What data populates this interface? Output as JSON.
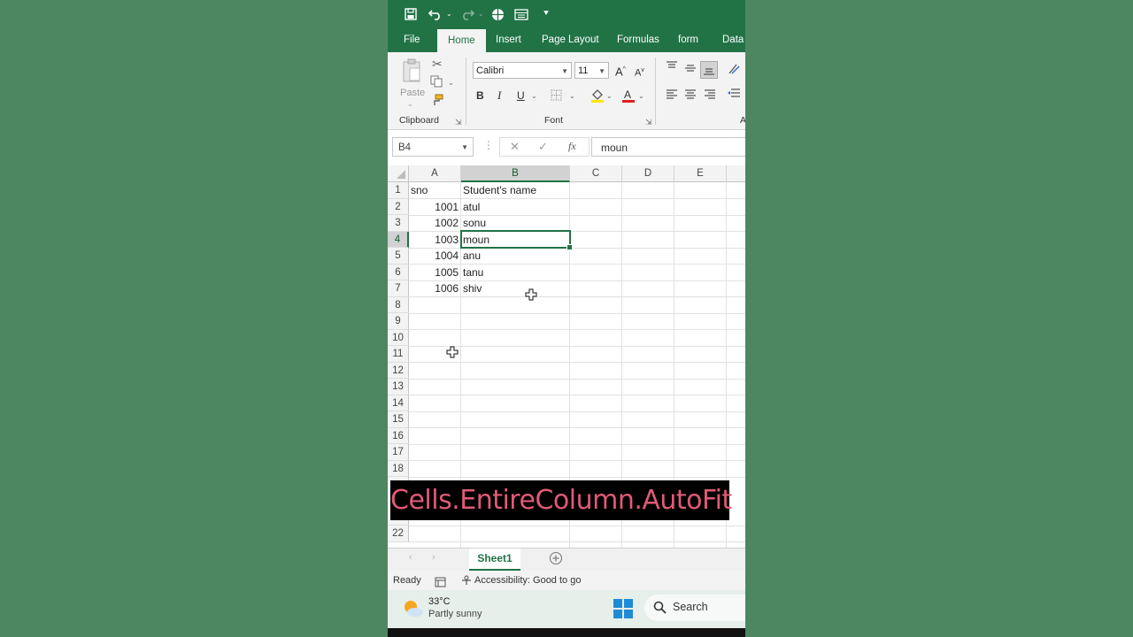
{
  "ribbon_tabs": [
    "File",
    "Home",
    "Insert",
    "Page Layout",
    "Formulas",
    "form",
    "Data"
  ],
  "ribbon": {
    "clipboard": {
      "paste_label": "Paste",
      "group_label": "Clipboard"
    },
    "font": {
      "font_name": "Calibri",
      "font_size": "11",
      "bold": "B",
      "italic": "I",
      "underline": "U",
      "group_label": "Font"
    },
    "alignment_group_label": "A"
  },
  "formula_bar": {
    "name_box": "B4",
    "fx_label": "fx",
    "value": "moun"
  },
  "columns": [
    "A",
    "B",
    "C",
    "D",
    "E"
  ],
  "rows": [
    "1",
    "2",
    "3",
    "4",
    "5",
    "6",
    "7",
    "8",
    "9",
    "10",
    "11",
    "12",
    "13",
    "14",
    "15",
    "16",
    "17",
    "18",
    "22"
  ],
  "cells": {
    "A1": "sno",
    "B1": "Student's name",
    "A2": "1001",
    "B2": "atul",
    "A3": "1002",
    "B3": "sonu",
    "A4": "1003",
    "B4": "moun",
    "A5": "1004",
    "B5": "anu",
    "A6": "1005",
    "B6": "tanu",
    "A7": "1006",
    "B7": "shiv"
  },
  "overlay_caption": "Cells.EntireColumn.AutoFit",
  "sheet_tabs": [
    "Sheet1"
  ],
  "status": {
    "ready": "Ready",
    "accessibility": "Accessibility: Good to go"
  },
  "taskbar": {
    "temperature": "33°C",
    "weather": "Partly sunny",
    "search_label": "Search"
  },
  "colors": {
    "excel_green": "#217346",
    "background": "#4d8762",
    "caption_text": "#e05a76"
  }
}
